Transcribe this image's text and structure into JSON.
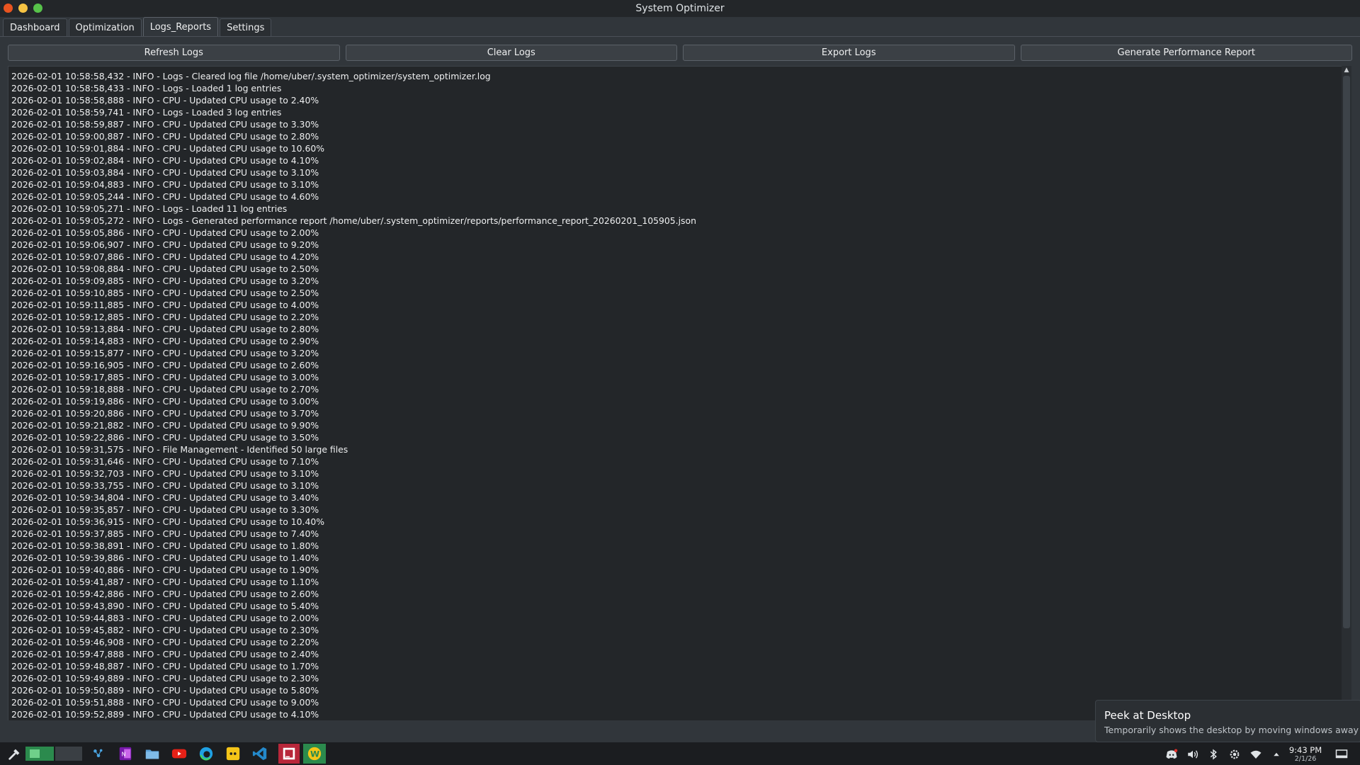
{
  "window": {
    "title": "System Optimizer"
  },
  "tabs": [
    {
      "label": "Dashboard",
      "active": false
    },
    {
      "label": "Optimization",
      "active": false
    },
    {
      "label": "Logs_Reports",
      "active": true
    },
    {
      "label": "Settings",
      "active": false
    }
  ],
  "toolbar": {
    "refresh_label": "Refresh Logs",
    "clear_label": "Clear Logs",
    "export_label": "Export Logs",
    "report_label": "Generate Performance Report"
  },
  "logs": [
    "2026-02-01 10:58:58,432 - INFO - Logs - Cleared log file /home/uber/.system_optimizer/system_optimizer.log",
    "2026-02-01 10:58:58,433 - INFO - Logs - Loaded 1 log entries",
    "2026-02-01 10:58:58,888 - INFO - CPU - Updated CPU usage to 2.40%",
    "2026-02-01 10:58:59,741 - INFO - Logs - Loaded 3 log entries",
    "2026-02-01 10:58:59,887 - INFO - CPU - Updated CPU usage to 3.30%",
    "2026-02-01 10:59:00,887 - INFO - CPU - Updated CPU usage to 2.80%",
    "2026-02-01 10:59:01,884 - INFO - CPU - Updated CPU usage to 10.60%",
    "2026-02-01 10:59:02,884 - INFO - CPU - Updated CPU usage to 4.10%",
    "2026-02-01 10:59:03,884 - INFO - CPU - Updated CPU usage to 3.10%",
    "2026-02-01 10:59:04,883 - INFO - CPU - Updated CPU usage to 3.10%",
    "2026-02-01 10:59:05,244 - INFO - CPU - Updated CPU usage to 4.60%",
    "2026-02-01 10:59:05,271 - INFO - Logs - Loaded 11 log entries",
    "2026-02-01 10:59:05,272 - INFO - Logs - Generated performance report /home/uber/.system_optimizer/reports/performance_report_20260201_105905.json",
    "2026-02-01 10:59:05,886 - INFO - CPU - Updated CPU usage to 2.00%",
    "2026-02-01 10:59:06,907 - INFO - CPU - Updated CPU usage to 9.20%",
    "2026-02-01 10:59:07,886 - INFO - CPU - Updated CPU usage to 4.20%",
    "2026-02-01 10:59:08,884 - INFO - CPU - Updated CPU usage to 2.50%",
    "2026-02-01 10:59:09,885 - INFO - CPU - Updated CPU usage to 3.20%",
    "2026-02-01 10:59:10,885 - INFO - CPU - Updated CPU usage to 2.50%",
    "2026-02-01 10:59:11,885 - INFO - CPU - Updated CPU usage to 4.00%",
    "2026-02-01 10:59:12,885 - INFO - CPU - Updated CPU usage to 2.20%",
    "2026-02-01 10:59:13,884 - INFO - CPU - Updated CPU usage to 2.80%",
    "2026-02-01 10:59:14,883 - INFO - CPU - Updated CPU usage to 2.90%",
    "2026-02-01 10:59:15,877 - INFO - CPU - Updated CPU usage to 3.20%",
    "2026-02-01 10:59:16,905 - INFO - CPU - Updated CPU usage to 2.60%",
    "2026-02-01 10:59:17,885 - INFO - CPU - Updated CPU usage to 3.00%",
    "2026-02-01 10:59:18,888 - INFO - CPU - Updated CPU usage to 2.70%",
    "2026-02-01 10:59:19,886 - INFO - CPU - Updated CPU usage to 3.00%",
    "2026-02-01 10:59:20,886 - INFO - CPU - Updated CPU usage to 3.70%",
    "2026-02-01 10:59:21,882 - INFO - CPU - Updated CPU usage to 9.90%",
    "2026-02-01 10:59:22,886 - INFO - CPU - Updated CPU usage to 3.50%",
    "2026-02-01 10:59:31,575 - INFO - File Management - Identified 50 large files",
    "2026-02-01 10:59:31,646 - INFO - CPU - Updated CPU usage to 7.10%",
    "2026-02-01 10:59:32,703 - INFO - CPU - Updated CPU usage to 3.10%",
    "2026-02-01 10:59:33,755 - INFO - CPU - Updated CPU usage to 3.10%",
    "2026-02-01 10:59:34,804 - INFO - CPU - Updated CPU usage to 3.40%",
    "2026-02-01 10:59:35,857 - INFO - CPU - Updated CPU usage to 3.30%",
    "2026-02-01 10:59:36,915 - INFO - CPU - Updated CPU usage to 10.40%",
    "2026-02-01 10:59:37,885 - INFO - CPU - Updated CPU usage to 7.40%",
    "2026-02-01 10:59:38,891 - INFO - CPU - Updated CPU usage to 1.80%",
    "2026-02-01 10:59:39,886 - INFO - CPU - Updated CPU usage to 1.40%",
    "2026-02-01 10:59:40,886 - INFO - CPU - Updated CPU usage to 1.90%",
    "2026-02-01 10:59:41,887 - INFO - CPU - Updated CPU usage to 1.10%",
    "2026-02-01 10:59:42,886 - INFO - CPU - Updated CPU usage to 2.60%",
    "2026-02-01 10:59:43,890 - INFO - CPU - Updated CPU usage to 5.40%",
    "2026-02-01 10:59:44,883 - INFO - CPU - Updated CPU usage to 2.00%",
    "2026-02-01 10:59:45,882 - INFO - CPU - Updated CPU usage to 2.30%",
    "2026-02-01 10:59:46,908 - INFO - CPU - Updated CPU usage to 2.20%",
    "2026-02-01 10:59:47,888 - INFO - CPU - Updated CPU usage to 2.40%",
    "2026-02-01 10:59:48,887 - INFO - CPU - Updated CPU usage to 1.70%",
    "2026-02-01 10:59:49,889 - INFO - CPU - Updated CPU usage to 2.30%",
    "2026-02-01 10:59:50,889 - INFO - CPU - Updated CPU usage to 5.80%",
    "2026-02-01 10:59:51,888 - INFO - CPU - Updated CPU usage to 9.00%",
    "2026-02-01 10:59:52,889 - INFO - CPU - Updated CPU usage to 4.10%"
  ],
  "tooltip": {
    "title": "Peek at Desktop",
    "description": "Temporarily shows the desktop by moving windows away"
  },
  "taskbar": {
    "apps": [
      "launcher-icon",
      "desktop-pager-icon",
      "kde-connect-icon",
      "onenote-icon",
      "file-manager-icon",
      "youtube-icon",
      "edge-browser-icon",
      "plex-icon",
      "vscode-icon",
      "jetbrains-icon",
      "w-app-icon"
    ],
    "tray": [
      "discord-icon",
      "volume-icon",
      "bluetooth-icon",
      "settings-icon",
      "wifi-icon",
      "expand-tray-icon",
      "peek-desktop-icon"
    ],
    "clock": {
      "time": "9:43 PM",
      "date": "2/1/26"
    }
  },
  "colors": {
    "background": "#31363b",
    "log_background": "#232629",
    "titlebar": "#232629",
    "taskbar": "#1b1d20",
    "text": "#eff0f1"
  }
}
